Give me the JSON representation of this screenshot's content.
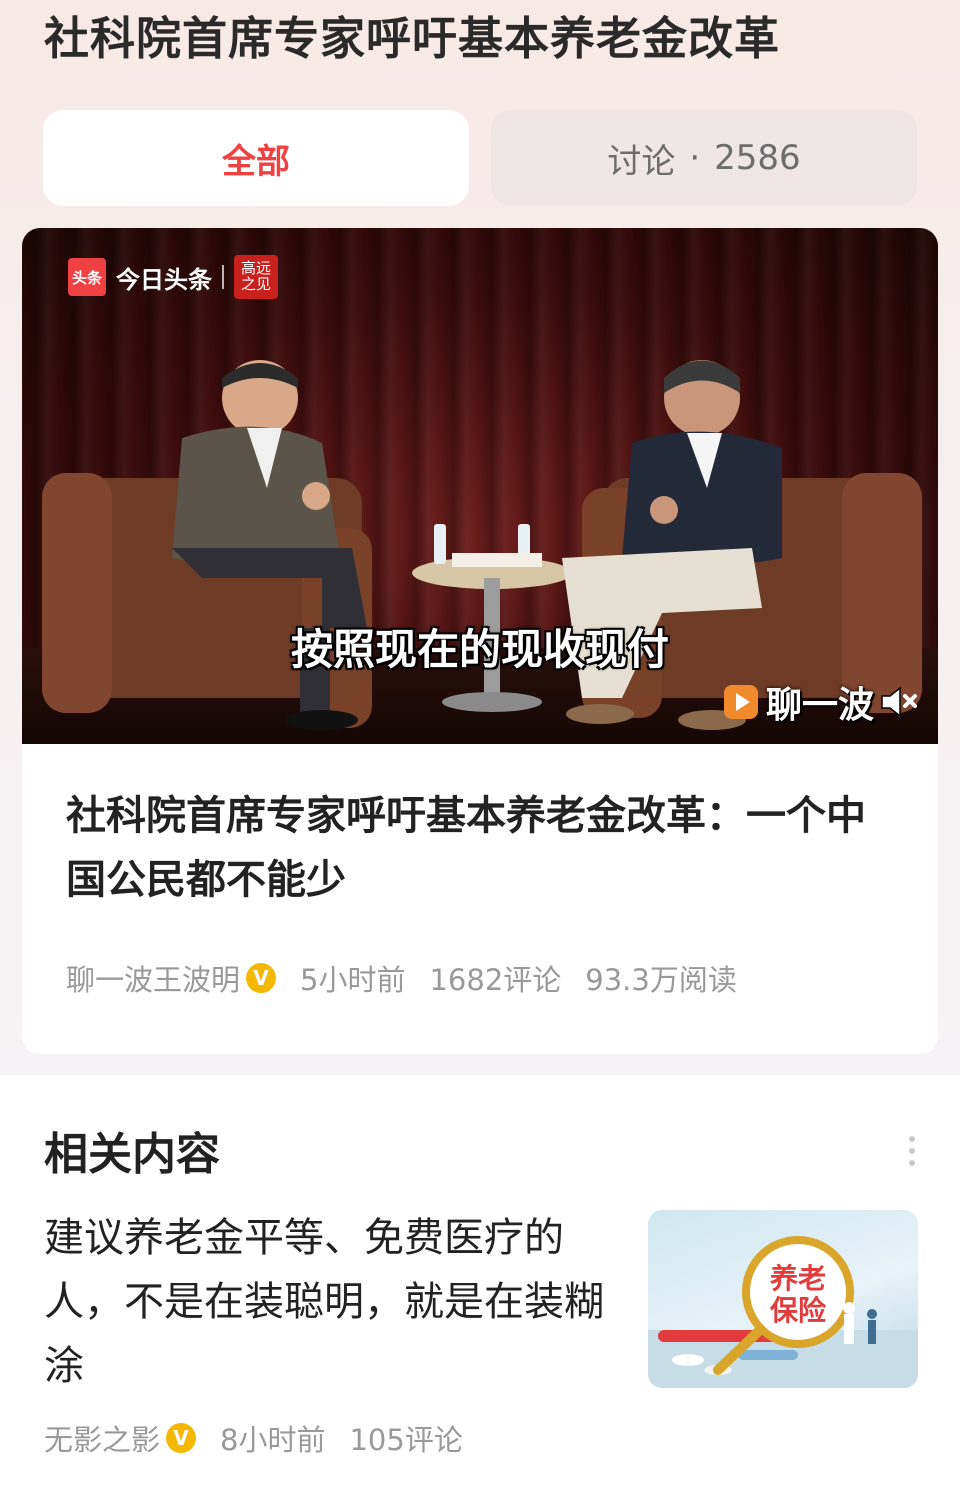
{
  "page": {
    "title": "社科院首席专家呼吁基本养老金改革"
  },
  "tabs": {
    "all_label": "全部",
    "discuss_label": "讨论",
    "discuss_separator": "·",
    "discuss_count": "2586"
  },
  "video": {
    "logo_badge": "头条",
    "logo_text": "今日头条",
    "seal_text": "高远之见",
    "subtitle": "按照现在的现收现付",
    "channel_mark": "聊一波",
    "mute_icon": "speaker-muted-icon"
  },
  "article": {
    "title": "社科院首席专家呼吁基本养老金改革：一个中国公民都不能少",
    "author": "聊一波王波明",
    "verified_badge": "V",
    "time": "5小时前",
    "comments": "1682评论",
    "reads": "93.3万阅读"
  },
  "related": {
    "header": "相关内容",
    "more_icon": "more-vertical-icon",
    "items": [
      {
        "title": "建议养老金平等、免费医疗的人，不是在装聪明，就是在装糊涂",
        "thumb_text_1": "养老",
        "thumb_text_2": "保险",
        "author": "无影之影",
        "verified_badge": "V",
        "time": "8小时前",
        "comments": "105评论"
      }
    ]
  },
  "colors": {
    "accent_red": "#f04142",
    "verified_gold": "#f5b800",
    "meta_gray": "#999999"
  }
}
